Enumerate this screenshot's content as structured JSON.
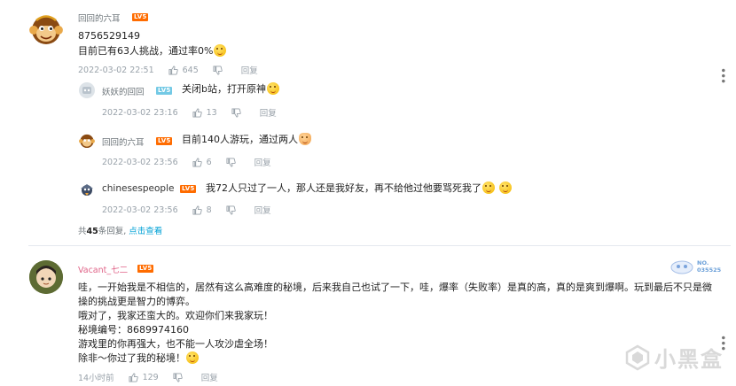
{
  "comment1": {
    "username": "回回的六耳",
    "level": "LV5",
    "lines": [
      "8756529149",
      "目前已有63人挑战，通过率0%"
    ],
    "time": "2022-03-02 22:51",
    "likes": "645",
    "reply_label": "回复",
    "replies": [
      {
        "username": "妖妖的回回",
        "level": "LV5",
        "text": "关闭b站，打开原神",
        "time": "2022-03-02 23:16",
        "likes": "13",
        "reply_label": "回复"
      },
      {
        "username": "回回的六耳",
        "level": "LV5",
        "text": "目前140人游玩，通过两人",
        "time": "2022-03-02 23:56",
        "likes": "6",
        "reply_label": "回复"
      },
      {
        "username": "chinesespeople",
        "level": "LV5",
        "text": "我72人只过了一人，那人还是我好友，再不给他过他要骂死我了",
        "time": "2022-03-02 23:56",
        "likes": "8",
        "reply_label": "回复"
      }
    ],
    "summary_prefix": "共",
    "summary_count": "45",
    "summary_suffix": "条回复,",
    "summary_link": "点击查看"
  },
  "comment2": {
    "username": "Vacant_七二",
    "level": "LV5",
    "stamp_line1": "NO.",
    "stamp_line2": "035525",
    "lines": [
      "哇，一开始我是不相信的，居然有这么高难度的秘境，后来我自己也试了一下，哇，爆率（失败率）是真的高，真的是爽到爆啊。玩到最后不只是微",
      "操的挑战更是智力的博弈。",
      "哦对了，我家还蛮大的。欢迎你们来我家玩！",
      "秘境编号：8689974160",
      "游戏里的你再强大，也不能一人攻沙虐全场！",
      "除非～你过了我的秘境！"
    ],
    "time": "14小时前",
    "likes": "129",
    "reply_label": "回复"
  },
  "watermark": "小黑盒",
  "colors": {
    "level_badge": "#ff6c00",
    "link": "#00a1d6",
    "meta": "#99a2aa"
  }
}
